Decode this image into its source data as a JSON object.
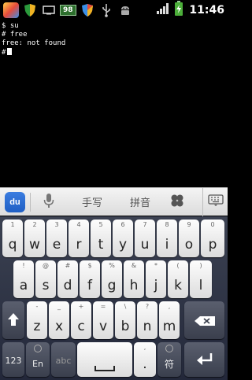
{
  "statusbar": {
    "battery_badge": "98",
    "time": "11:46"
  },
  "terminal": {
    "lines": [
      "$ su",
      "# free",
      "free: not found",
      "#"
    ]
  },
  "ime_toolbar": {
    "logo": "du",
    "handwriting_label": "手写",
    "pinyin_label": "拼音"
  },
  "keyboard": {
    "row1": [
      {
        "main": "q",
        "sub": "1"
      },
      {
        "main": "w",
        "sub": "2"
      },
      {
        "main": "e",
        "sub": "3"
      },
      {
        "main": "r",
        "sub": "4"
      },
      {
        "main": "t",
        "sub": "5"
      },
      {
        "main": "y",
        "sub": "6"
      },
      {
        "main": "u",
        "sub": "7"
      },
      {
        "main": "i",
        "sub": "8"
      },
      {
        "main": "o",
        "sub": "9"
      },
      {
        "main": "p",
        "sub": "0"
      }
    ],
    "row2": [
      {
        "main": "a",
        "sub": "!"
      },
      {
        "main": "s",
        "sub": "@"
      },
      {
        "main": "d",
        "sub": "#"
      },
      {
        "main": "f",
        "sub": "$"
      },
      {
        "main": "g",
        "sub": "%"
      },
      {
        "main": "h",
        "sub": "&"
      },
      {
        "main": "j",
        "sub": "*"
      },
      {
        "main": "k",
        "sub": "("
      },
      {
        "main": "l",
        "sub": ")"
      }
    ],
    "row3": [
      {
        "main": "z",
        "sub": "-"
      },
      {
        "main": "x",
        "sub": "_"
      },
      {
        "main": "c",
        "sub": "+"
      },
      {
        "main": "v",
        "sub": "="
      },
      {
        "main": "b",
        "sub": "\\"
      },
      {
        "main": "n",
        "sub": "?"
      },
      {
        "main": "m",
        "sub": ","
      }
    ],
    "row4": {
      "num": "123",
      "lang": "En",
      "abc": "abc",
      "period_main": ".",
      "period_sub": ",",
      "symbol": "符"
    }
  }
}
